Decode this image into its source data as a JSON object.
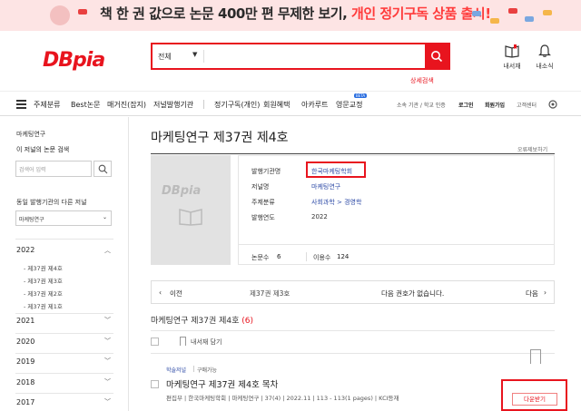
{
  "banner": {
    "text_part1": "책 한 권 값으로 논문 400만 편 무제한 보기,",
    "text_part2": "개인 정기구독 상품 출시!"
  },
  "header": {
    "logo": "DBpia",
    "search_scope": "전체",
    "search_value": "",
    "detail_search": "상세검색",
    "library_label": "내서재",
    "notifications_label": "내소식"
  },
  "nav": {
    "items": [
      "주제분류",
      "Best논문",
      "매거진(잡지)",
      "저널발행기관",
      "정기구독(개인)",
      "회원혜택",
      "아카루트",
      "영문교정"
    ],
    "beta_badge": "BETA",
    "util": {
      "affiliation": "소속 기관 / 학교 인증",
      "login": "로그인",
      "signup": "회원가입",
      "support": "고객센터"
    }
  },
  "sidebar": {
    "journal_name": "마케팅연구",
    "in_journal_search": "이 저널의 논문 검색",
    "search_placeholder": "검색어 입력",
    "other_journals_label": "동일 발행기관의 다른 저널",
    "other_journal_selected": "마케팅연구",
    "years": [
      {
        "year": "2022",
        "expanded": true,
        "issues": [
          "- 제37권 제4호",
          "- 제37권 제3호",
          "- 제37권 제2호",
          "- 제37권 제1호"
        ]
      },
      {
        "year": "2021",
        "expanded": false
      },
      {
        "year": "2020",
        "expanded": false
      },
      {
        "year": "2019",
        "expanded": false
      },
      {
        "year": "2018",
        "expanded": false
      },
      {
        "year": "2017",
        "expanded": false
      }
    ]
  },
  "issue": {
    "title": "마케팅연구 제37권 제4호",
    "error_report": "오류제보하기",
    "cover_logo": "DBpia",
    "fields": [
      {
        "label": "발행기관명",
        "value": "한국마케팅학회"
      },
      {
        "label": "저널명",
        "value": "마케팅연구"
      },
      {
        "label": "주제분류",
        "value": "사회과학 > 경영학"
      },
      {
        "label": "발행연도",
        "value": "2022"
      }
    ],
    "paper_count_label": "논문수",
    "paper_count": "6",
    "usage_label": "이용수",
    "usage": "124"
  },
  "pager": {
    "prev": "이전",
    "current": "제37권 제3호",
    "next_message": "다음 권호가 없습니다.",
    "next": "다음"
  },
  "list": {
    "section_title": "마케팅연구 제37권 제4호",
    "section_count": "(6)",
    "save_to_library": "내서재 담기",
    "articles": [
      {
        "tag_type": "학술저널",
        "tag_access": "구매가능",
        "title": "마케팅연구 제37권 제4호 목차",
        "meta": "편집부 | 한국마케팅학회 | 마케팅연구 | 37(4) | 2022.11 | 113 - 113(1 pages) | KCI등재",
        "download": "다운받기"
      }
    ]
  }
}
